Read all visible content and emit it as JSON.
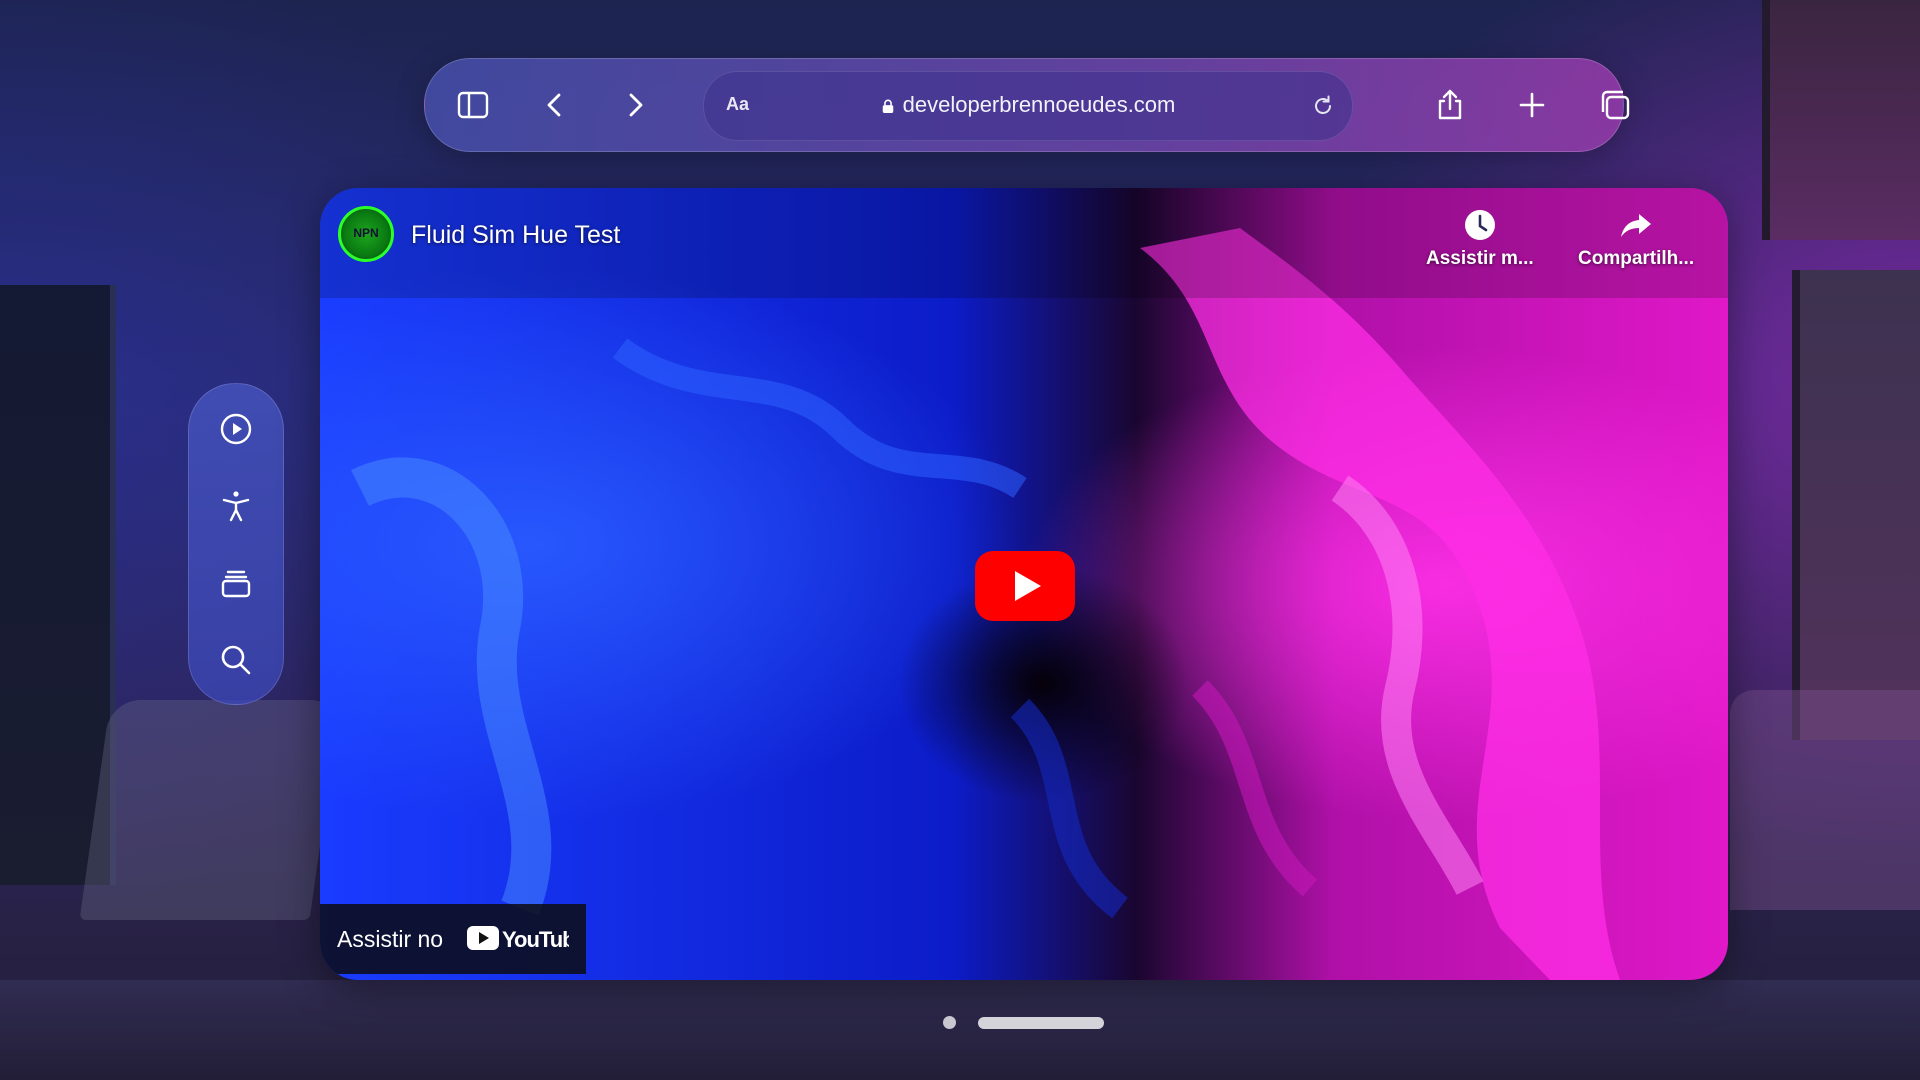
{
  "window": {
    "address_bar": {
      "reader_label": "Aa",
      "url": "developerbrennoeudes.com"
    },
    "toolbar_icons": [
      "sidebar-icon",
      "back-icon",
      "forward-icon",
      "lock-icon",
      "reload-icon",
      "share-icon",
      "new-tab-icon",
      "tabs-overview-icon"
    ]
  },
  "sidebar": {
    "icons": [
      "play-circle-icon",
      "accessibility-icon",
      "stack-icon",
      "search-icon"
    ]
  },
  "video": {
    "channel_logo_text": "NPN",
    "title": "Fluid Sim Hue Test",
    "actions": [
      {
        "icon": "clock-icon",
        "label": "Assistir m..."
      },
      {
        "icon": "share-arrow-icon",
        "label": "Compartilh..."
      }
    ],
    "watch_on_label": "Assistir no",
    "platform_logo_text": "YouTube",
    "colors": {
      "play_button": "#ff0000",
      "fluid_blue": "#1030ff",
      "fluid_magenta": "#ff10d0"
    }
  }
}
